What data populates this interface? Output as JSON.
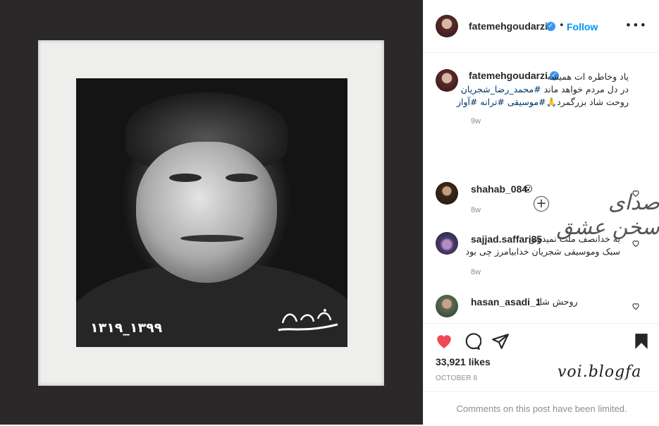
{
  "post_image": {
    "dates_text": "۱۳۱۹_۱۳۹۹",
    "logo_text": "صبح سینما"
  },
  "header": {
    "username": "fatemehgoudarzi",
    "separator": "•",
    "follow_label": "Follow",
    "more_label": "•••"
  },
  "caption": {
    "username": "fatemehgoudarzi",
    "line1": "یاد وخاطره ات همیشه",
    "line2_prefix": "در دل مردم خواهد ماند ",
    "line2_tag": "#محمد_رضا_شجریان",
    "line3_prefix": "روحت شاد بزرگمرد🙏",
    "line3_tags": "#موسیقی #ترانه #آواز",
    "time": "9w",
    "calligraphy": "صدای سخن عشق",
    "plus": "+"
  },
  "comments": [
    {
      "username": "shahab_084",
      "text": "😮",
      "time": "8w"
    },
    {
      "username": "sajjad.saffari85",
      "text_line1": "به خدانصف ملت نمیدونن",
      "text_line2": "سبک وموسیقی شجریان خدابیامرز چی بود",
      "time": "8w"
    },
    {
      "username": "hasan_asadi_1",
      "text": "روحش شاد"
    }
  ],
  "actions": {
    "likes": "33,921 likes",
    "date": "OCTOBER 8",
    "watermark": "voi.blogfa",
    "limited_message": "Comments on this post have been limited."
  },
  "colors": {
    "accent_blue": "#0095f6",
    "heart_red": "#ed4956",
    "muted": "#8e8e8e"
  }
}
